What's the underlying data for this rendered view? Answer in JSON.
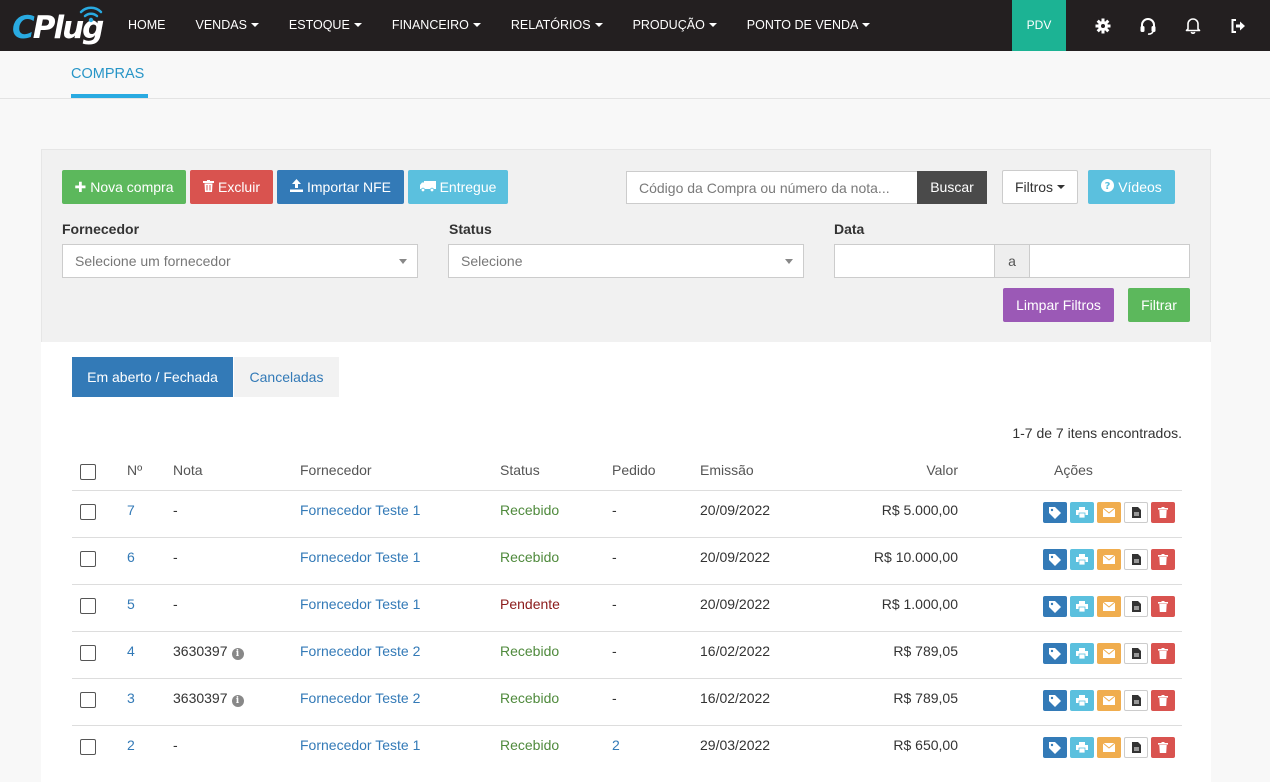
{
  "navbar": {
    "logo_text_c": "C",
    "logo_text_rest": "Plug",
    "items": [
      {
        "label": "HOME",
        "dropdown": false
      },
      {
        "label": "VENDAS",
        "dropdown": true
      },
      {
        "label": "ESTOQUE",
        "dropdown": true
      },
      {
        "label": "FINANCEIRO",
        "dropdown": true
      },
      {
        "label": "RELATÓRIOS",
        "dropdown": true
      },
      {
        "label": "PRODUÇÃO",
        "dropdown": true
      },
      {
        "label": "PONTO DE VENDA",
        "dropdown": true
      }
    ],
    "pdv_label": "PDV",
    "icons": [
      "gear-icon",
      "headset-icon",
      "bell-icon",
      "logout-icon"
    ],
    "bg_color": "#231f20",
    "pdv_color": "#1cb394"
  },
  "subheader": {
    "tab_label": "COMPRAS"
  },
  "toolbar": {
    "new_label": "Nova compra",
    "delete_label": "Excluir",
    "import_label": "Importar NFE",
    "delivered_label": "Entregue",
    "search_placeholder": "Código da Compra ou número da nota...",
    "search_button": "Buscar",
    "filters_label": "Filtros",
    "videos_label": "Vídeos"
  },
  "filters": {
    "supplier_label": "Fornecedor",
    "supplier_placeholder": "Selecione um fornecedor",
    "status_label": "Status",
    "status_placeholder": "Selecione",
    "date_label": "Data",
    "date_separator": "a",
    "clear_label": "Limpar Filtros",
    "apply_label": "Filtrar"
  },
  "tabs": {
    "open_closed": "Em aberto / Fechada",
    "canceled": "Canceladas"
  },
  "results": {
    "count_text": "1-7 de 7 itens encontrados."
  },
  "table": {
    "headers": {
      "number": "Nº",
      "nota": "Nota",
      "supplier": "Fornecedor",
      "status": "Status",
      "order": "Pedido",
      "issue": "Emissão",
      "value": "Valor",
      "actions": "Ações"
    },
    "rows": [
      {
        "number": "7",
        "nota": "-",
        "nota_info": false,
        "supplier": "Fornecedor Teste 1",
        "status": "Recebido",
        "status_type": "ok",
        "order": "-",
        "issue": "20/09/2022",
        "value": "R$ 5.000,00"
      },
      {
        "number": "6",
        "nota": "-",
        "nota_info": false,
        "supplier": "Fornecedor Teste 1",
        "status": "Recebido",
        "status_type": "ok",
        "order": "-",
        "issue": "20/09/2022",
        "value": "R$ 10.000,00"
      },
      {
        "number": "5",
        "nota": "-",
        "nota_info": false,
        "supplier": "Fornecedor Teste 1",
        "status": "Pendente",
        "status_type": "pend",
        "order": "-",
        "issue": "20/09/2022",
        "value": "R$ 1.000,00"
      },
      {
        "number": "4",
        "nota": "3630397",
        "nota_info": true,
        "supplier": "Fornecedor Teste 2",
        "status": "Recebido",
        "status_type": "ok",
        "order": "-",
        "issue": "16/02/2022",
        "value": "R$ 789,05"
      },
      {
        "number": "3",
        "nota": "3630397",
        "nota_info": true,
        "supplier": "Fornecedor Teste 2",
        "status": "Recebido",
        "status_type": "ok",
        "order": "-",
        "issue": "16/02/2022",
        "value": "R$ 789,05"
      },
      {
        "number": "2",
        "nota": "-",
        "nota_info": false,
        "supplier": "Fornecedor Teste 1",
        "status": "Recebido",
        "status_type": "ok",
        "order": "2",
        "issue": "29/03/2022",
        "value": "R$ 650,00"
      }
    ]
  }
}
